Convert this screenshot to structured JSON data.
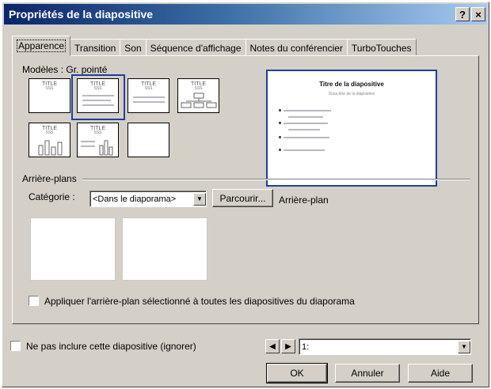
{
  "window": {
    "title": "Propriétés de la diapositive",
    "help_btn": "?",
    "close_btn": "×"
  },
  "tabs": [
    {
      "label": "Apparence",
      "active": true
    },
    {
      "label": "Transition"
    },
    {
      "label": "Son"
    },
    {
      "label": "Séquence d'affichage"
    },
    {
      "label": "Notes du conférencier"
    },
    {
      "label": "TurboTouches"
    }
  ],
  "models": {
    "label": "Modèles : Gr. pointé",
    "thumb_title": "TITLE",
    "thumb_sub": "SSS"
  },
  "preview": {
    "title": "Titre de la diapositive",
    "subtitle": "Sous-titre de la diapositive"
  },
  "backgrounds": {
    "group_label": "Arrière-plans",
    "category_label": "Catégorie :",
    "category_value": "<Dans le diaporama>",
    "browse_button": "Parcourir...",
    "background_label": "Arrière-plan",
    "apply_all_label": "Appliquer l'arrière-plan sélectionné à toutes les diapositives du diaporama"
  },
  "footer": {
    "skip_label": "Ne pas inclure cette diapositive (ignorer)",
    "slide_select_value": "1:",
    "ok": "OK",
    "cancel": "Annuler",
    "help": "Aide"
  },
  "icons": {
    "dropdown": "dropdown-arrow-icon",
    "prev": "left-arrow-icon",
    "next": "right-arrow-icon"
  },
  "colors": {
    "title_bar": "#0a246a",
    "selection": "#1f3f9f",
    "face": "#d4d0c8"
  }
}
